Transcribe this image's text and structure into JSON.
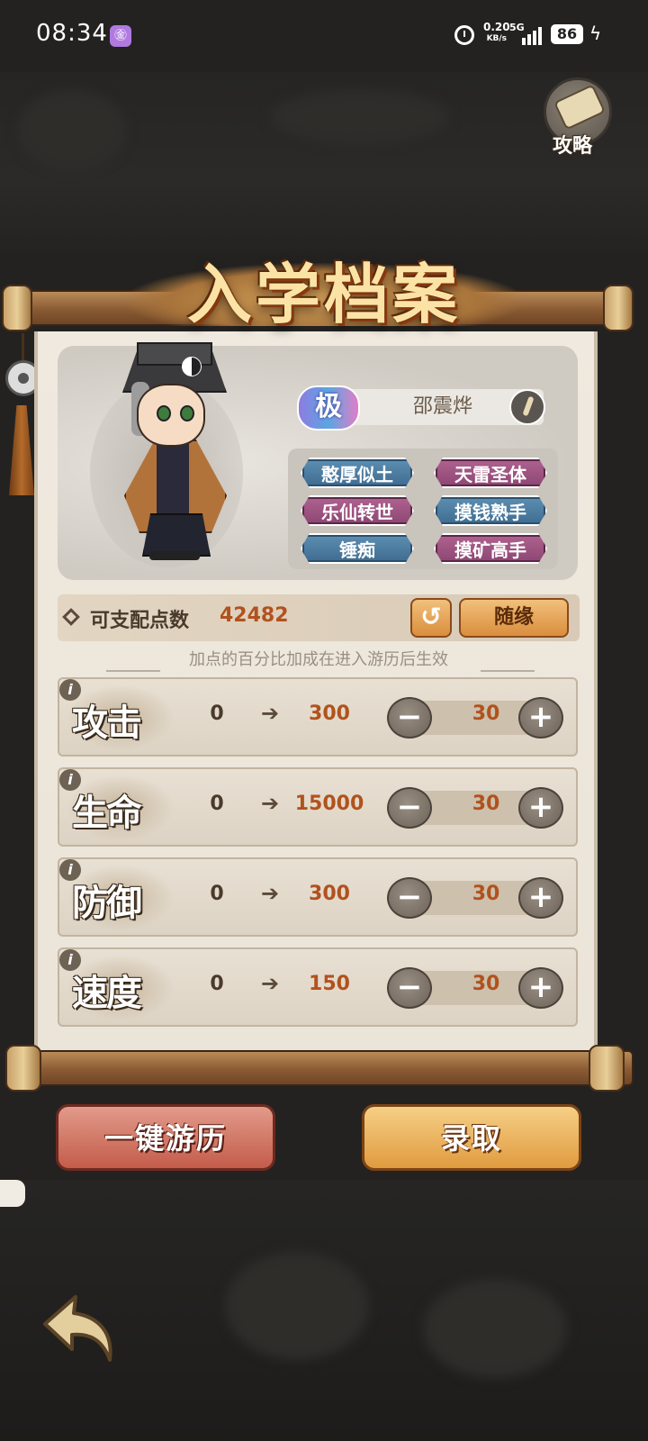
{
  "status_bar": {
    "time": "08:34",
    "app_icon_glyph": "㊎",
    "net_speed_value": "0.20",
    "net_speed_unit": "KB/s",
    "network": "5G",
    "battery": "86"
  },
  "guide": {
    "label": "攻略"
  },
  "title": "入学档案",
  "character": {
    "rank": "极",
    "name": "邵震烨",
    "traits": [
      {
        "label": "憨厚似土",
        "color": "blue"
      },
      {
        "label": "天雷圣体",
        "color": "pink"
      },
      {
        "label": "乐仙转世",
        "color": "pink"
      },
      {
        "label": "摸钱熟手",
        "color": "blue"
      },
      {
        "label": "锤痴",
        "color": "blue"
      },
      {
        "label": "摸矿高手",
        "color": "pink"
      }
    ]
  },
  "points": {
    "label": "可支配点数",
    "value": "42482",
    "reset_icon": "↺",
    "random_label": "随缘"
  },
  "hint": "加点的百分比加成在进入游历后生效",
  "stats": [
    {
      "name": "攻击",
      "base": "0",
      "target": "300",
      "step": "30"
    },
    {
      "name": "生命",
      "base": "0",
      "target": "15000",
      "step": "30"
    },
    {
      "name": "防御",
      "base": "0",
      "target": "300",
      "step": "30"
    },
    {
      "name": "速度",
      "base": "0",
      "target": "150",
      "step": "30"
    }
  ],
  "stepper": {
    "minus": "−",
    "plus": "+",
    "info": "i",
    "arrow": "➔"
  },
  "buttons": {
    "tour": "一键游历",
    "admit": "录取"
  },
  "colors": {
    "accent_orange": "#b1521d",
    "trait_blue": "#4a7ca0",
    "trait_pink": "#9c5281",
    "paper": "#ece6dc"
  }
}
